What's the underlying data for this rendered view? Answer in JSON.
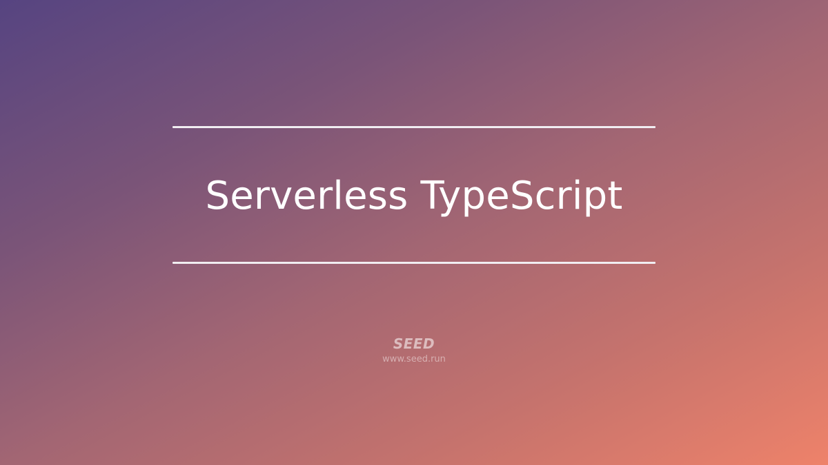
{
  "banner": {
    "title": "Serverless TypeScript",
    "brand": "SEED",
    "url": "www.seed.run"
  },
  "colors": {
    "gradient_start": "#564481",
    "gradient_end": "#ee826a",
    "text": "#ffffff"
  }
}
